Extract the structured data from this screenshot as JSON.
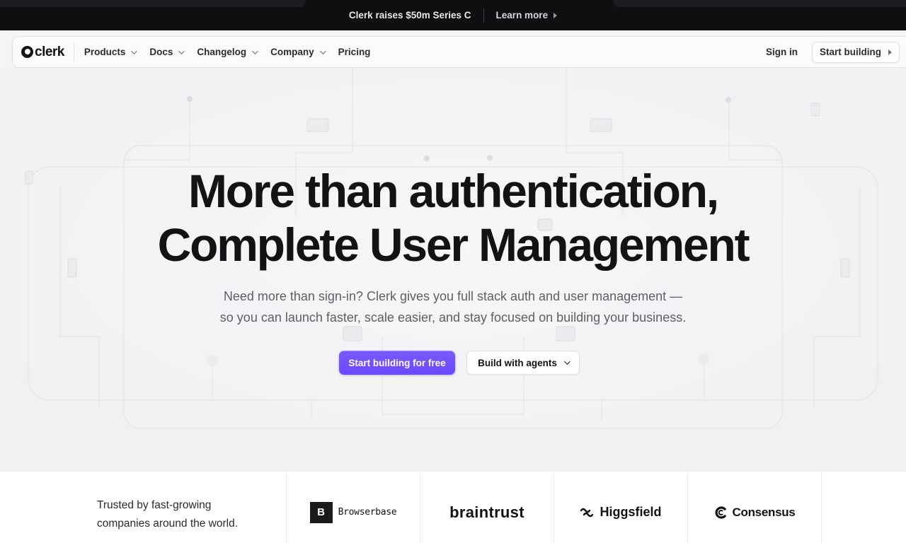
{
  "announcement": {
    "text": "Clerk raises $50m Series C",
    "link": "Learn more"
  },
  "nav": {
    "logo_text": "clerk",
    "items": [
      {
        "label": "Products",
        "has_dropdown": true
      },
      {
        "label": "Docs",
        "has_dropdown": true
      },
      {
        "label": "Changelog",
        "has_dropdown": true
      },
      {
        "label": "Company",
        "has_dropdown": true
      },
      {
        "label": "Pricing",
        "has_dropdown": false
      }
    ],
    "sign_in": "Sign in",
    "start_building": "Start building"
  },
  "hero": {
    "title_line1": "More than authentication,",
    "title_line2": "Complete User Management",
    "subtitle_line1": "Need more than sign-in? Clerk gives you full stack auth and user management —",
    "subtitle_line2": "so you can launch faster, scale easier, and stay focused on building your business.",
    "cta_primary": "Start building for free",
    "cta_secondary": "Build with agents"
  },
  "trusted": {
    "line1": "Trusted by fast-growing",
    "line2": "companies around the world.",
    "logos": [
      {
        "mark": "B",
        "name": "Browserbase"
      },
      {
        "name": "braintrust"
      },
      {
        "name": "Higgsfield"
      },
      {
        "name": "Consensus"
      }
    ]
  },
  "colors": {
    "accent": "#6c47ff",
    "dark": "#131316",
    "background": "#f5f5f6"
  }
}
